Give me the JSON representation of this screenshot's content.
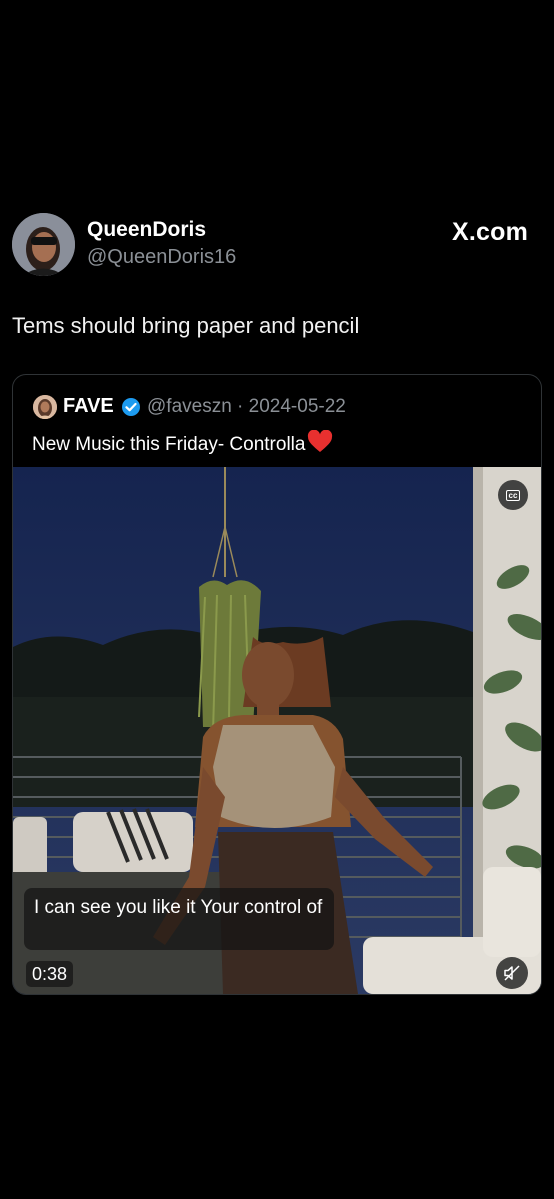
{
  "author": {
    "display_name": "QueenDoris",
    "handle": "@QueenDoris16",
    "avatar_icon": "profile-avatar"
  },
  "brand": "X.com",
  "tweet": {
    "text": "Tems should bring paper and pencil"
  },
  "quoted": {
    "display_name": "FAVE",
    "verified_icon": "verified-badge-icon",
    "meta": "@faveszn · 2024-05-22",
    "text": "New Music this Friday- Controlla",
    "emoji": "heart-icon"
  },
  "video": {
    "caption": "I can see you like it Your control of",
    "duration": "0:38",
    "cc_label": "cc",
    "accent_verified": "#1d9bf0",
    "heart_color": "#e8302f"
  }
}
